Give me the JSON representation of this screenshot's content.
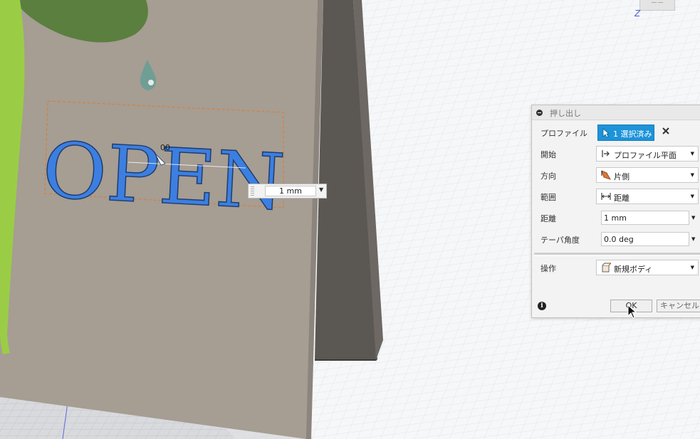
{
  "canvas": {
    "sign_text": "OPEN",
    "dimension_value": "1 mm",
    "angle_hint": "00",
    "axis_label": "Z",
    "viewcube_text": "ーー"
  },
  "dialog": {
    "title": "押し出し",
    "rows": {
      "profile": {
        "label": "プロファイル",
        "value": "1 選択済み"
      },
      "start": {
        "label": "開始",
        "value": "プロファイル平面"
      },
      "direction": {
        "label": "方向",
        "value": "片側"
      },
      "extent": {
        "label": "範囲",
        "value": "距離"
      },
      "distance": {
        "label": "距離",
        "value": "1 mm"
      },
      "taper": {
        "label": "テーパ角度",
        "value": "0.0 deg"
      },
      "operation": {
        "label": "操作",
        "value": "新規ボディ"
      }
    },
    "ok_label": "OK",
    "cancel_label": "キャンセル"
  },
  "colors": {
    "accent": "#1d93d9",
    "sign_board": "#a69d93",
    "letters": "#3c7fe0",
    "leaf": "#5a7f3e",
    "vine": "#9acd45"
  }
}
